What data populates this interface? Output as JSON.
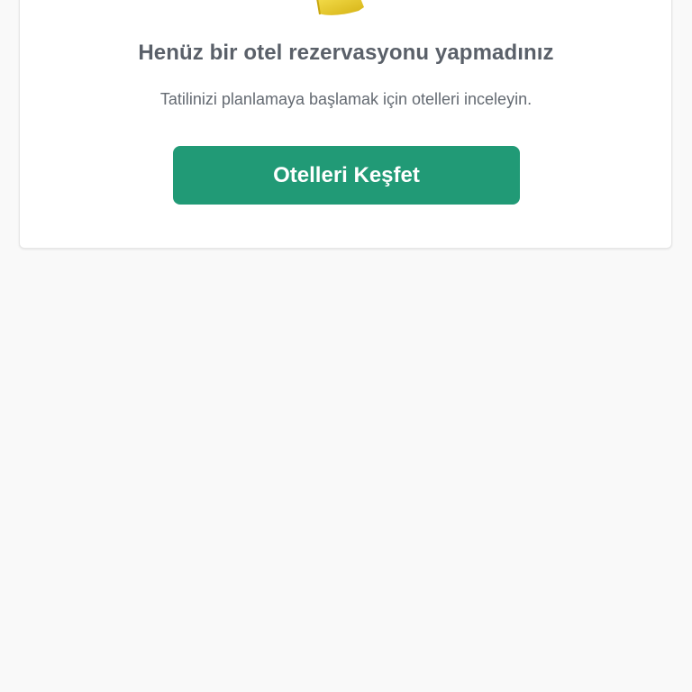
{
  "empty_state": {
    "illustration_icon": "hotel-illustration-icon",
    "title": "Henüz bir otel rezervasyonu yapmadınız",
    "subtitle": "Tatilinizi planlamaya başlamak için otelleri inceleyin.",
    "cta_label": "Otelleri Keşfet"
  },
  "colors": {
    "page_background": "#f9f9f9",
    "card_background": "#ffffff",
    "primary_button": "#219a76",
    "title_text": "#5a6069",
    "subtitle_text": "#646a72",
    "illustration_accent": "#e7c520"
  }
}
